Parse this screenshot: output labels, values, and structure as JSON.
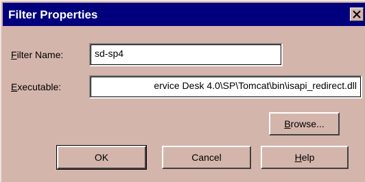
{
  "dialog": {
    "title": "Filter Properties",
    "filter_name": {
      "label_accel": "F",
      "label_rest": "ilter Name:",
      "value": "sd-sp4"
    },
    "executable": {
      "label_accel": "E",
      "label_rest": "xecutable:",
      "value": "ervice Desk 4.0\\SP\\Tomcat\\bin\\isapi_redirect.dll"
    },
    "buttons": {
      "browse": {
        "accel": "B",
        "rest": "rowse..."
      },
      "ok": {
        "label": "OK"
      },
      "cancel": {
        "label": "Cancel"
      },
      "help": {
        "accel": "H",
        "rest": "elp"
      }
    }
  },
  "icons": {
    "close": "close-icon"
  },
  "colors": {
    "titlebar": "#00007c",
    "face": "#d4b5ac"
  }
}
